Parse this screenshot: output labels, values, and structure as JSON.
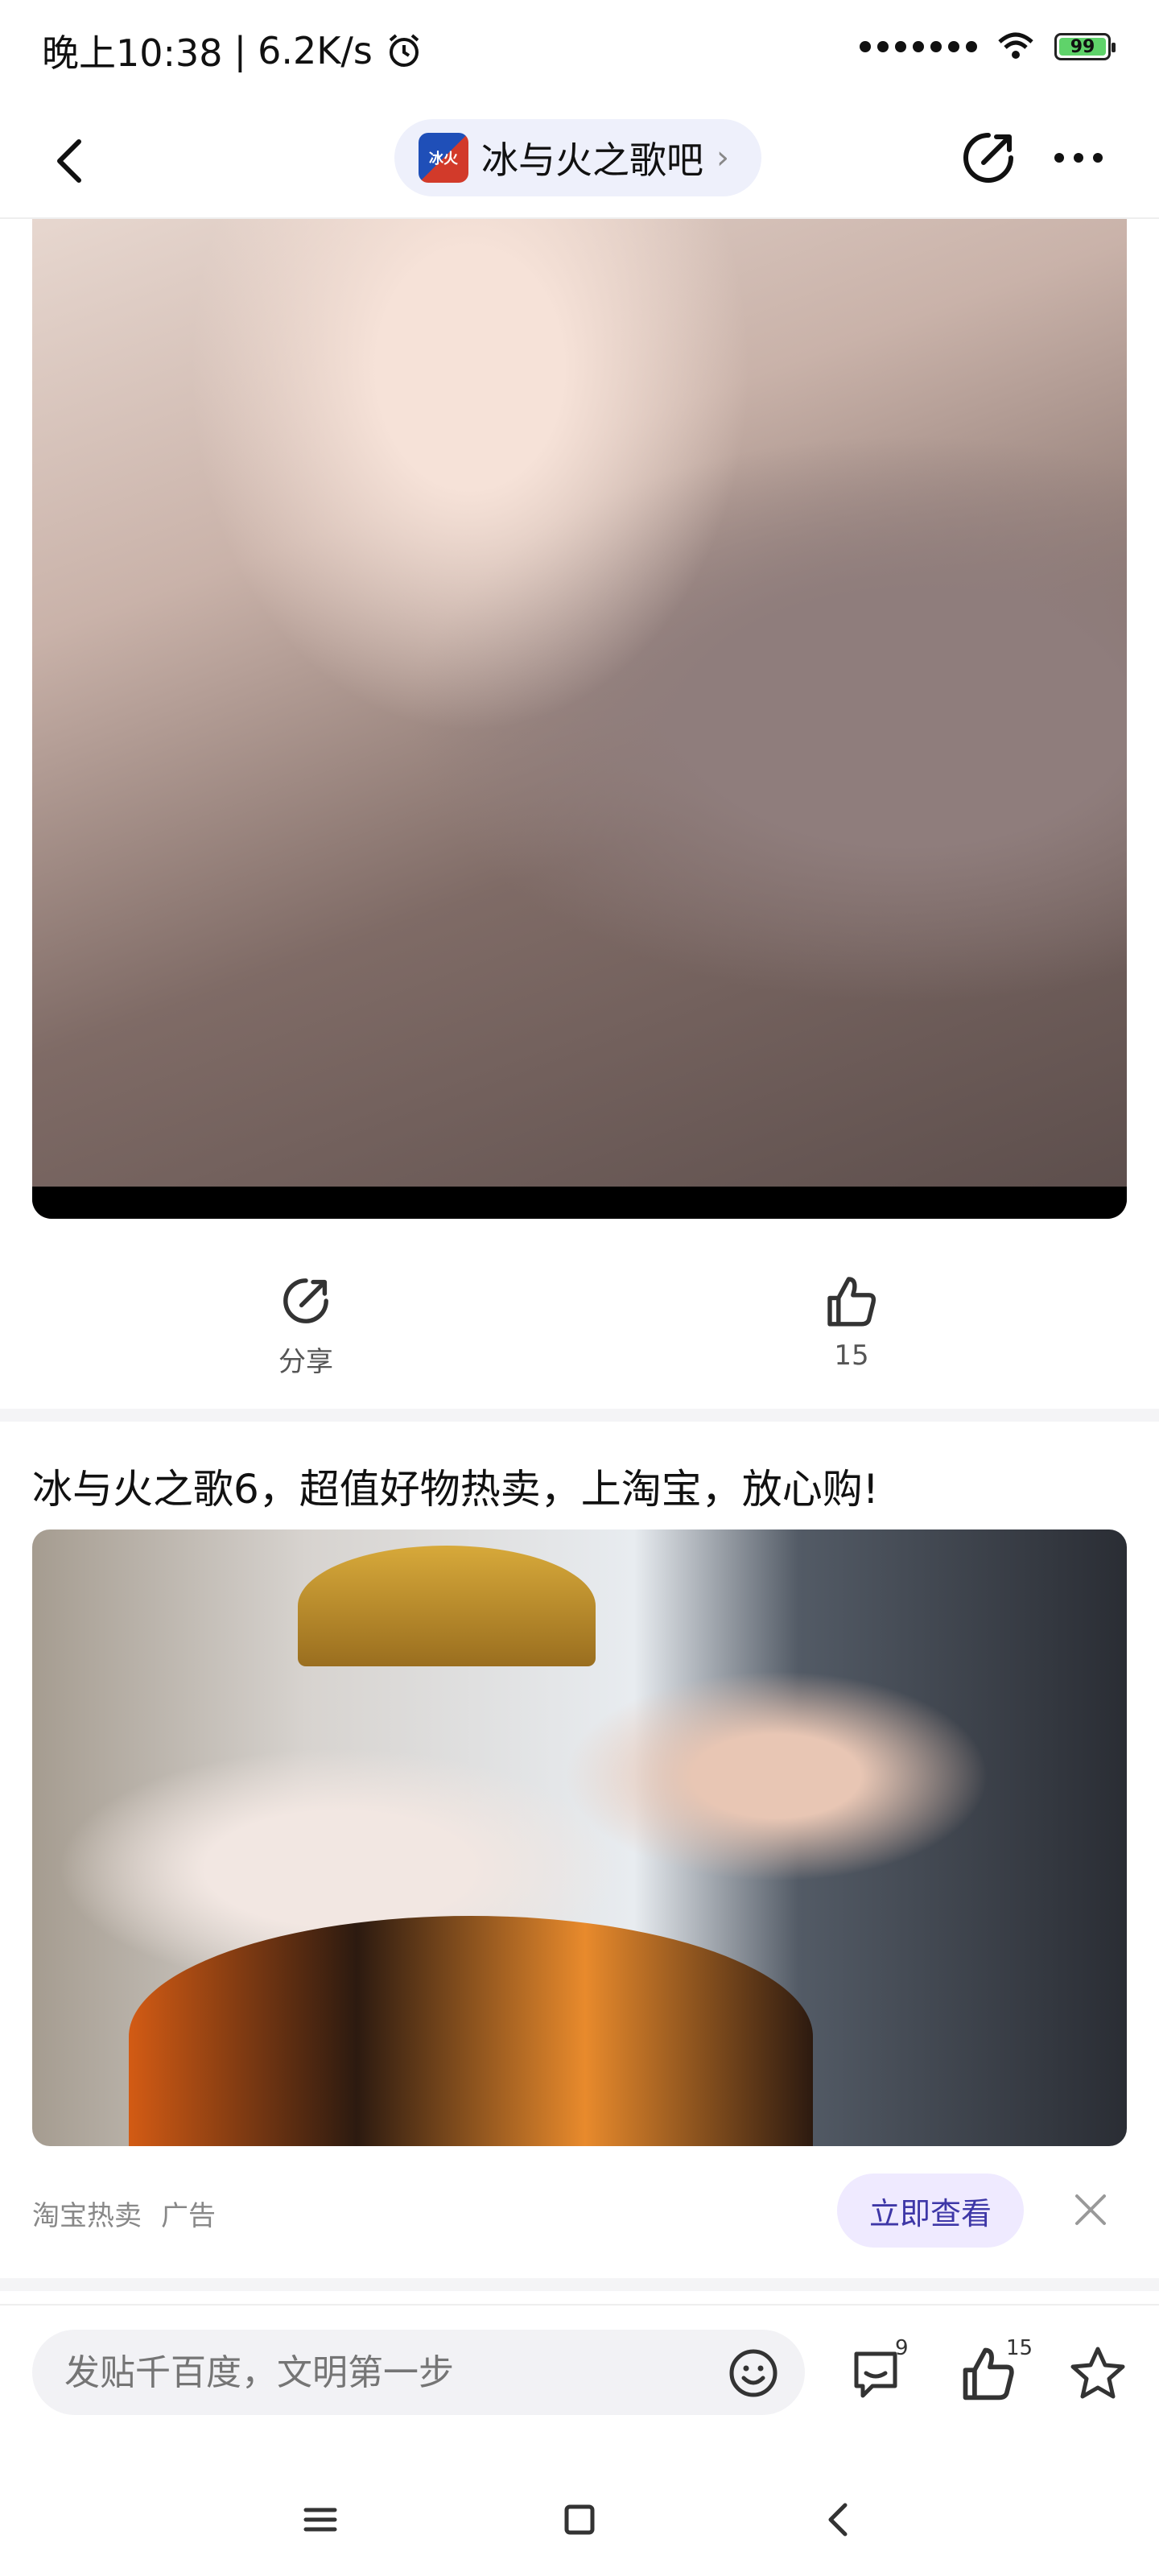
{
  "status_bar": {
    "time": "晚上10:38",
    "speed": "6.2K/s",
    "battery": "99",
    "icons": [
      "alarm-icon",
      "signal-icon",
      "wifi-icon",
      "battery-icon"
    ]
  },
  "header": {
    "forum_name": "冰与火之歌吧",
    "forum_avatar_text": "冰火"
  },
  "post": {
    "share_label": "分享",
    "like_count": "15"
  },
  "ad": {
    "title": "冰与火之歌6，超值好物热卖，上淘宝，放心购!",
    "source": "淘宝热卖",
    "tag": "广告",
    "cta": "立即查看"
  },
  "bottom_bar": {
    "placeholder": "发贴千百度，文明第一步",
    "comment_count": "9",
    "like_count": "15"
  },
  "colors": {
    "accent_pill": "#eef0fb",
    "cta_bg": "#efeaff",
    "cta_text": "#3e37a7",
    "battery_fill": "#5fd36a"
  }
}
